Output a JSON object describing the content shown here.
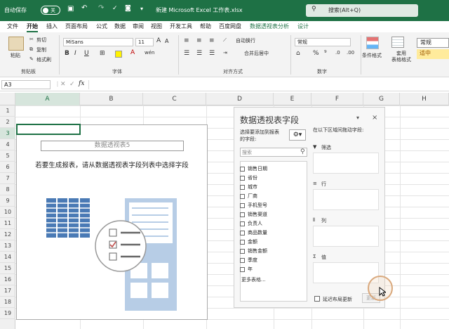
{
  "titlebar": {
    "autosave": "自动保存",
    "toggle": "关",
    "filename": "新建 Microsoft Excel 工作表.xlsx",
    "search": "搜索(Alt+Q)"
  },
  "menu": [
    "文件",
    "开始",
    "插入",
    "页面布局",
    "公式",
    "数据",
    "审阅",
    "视图",
    "开发工具",
    "帮助",
    "百度网盘",
    "数据透视表分析",
    "设计"
  ],
  "ribbon": {
    "paste": "粘贴",
    "cut": "剪切",
    "copy": "复制",
    "format_painter": "格式刷",
    "clipboard": "剪贴板",
    "font_name": "MiSans",
    "font_size": "11",
    "font": "字体",
    "wrap": "自动换行",
    "merge": "合并后居中",
    "alignment": "对齐方式",
    "number_format": "常规",
    "number": "数字",
    "cond_format": "条件格式",
    "table_format": "套用\n表格格式",
    "style_normal": "常规",
    "style_medium": "适中"
  },
  "formula": {
    "name_box": "A3",
    "fx": "fx"
  },
  "columns": [
    "A",
    "B",
    "C",
    "D",
    "E",
    "F",
    "G",
    "H"
  ],
  "rows": [
    "1",
    "2",
    "3",
    "4",
    "5",
    "6",
    "7",
    "8",
    "9",
    "10",
    "11",
    "12",
    "13",
    "14",
    "15",
    "16",
    "17",
    "18",
    "19"
  ],
  "pivot": {
    "name": "数据透视表5",
    "message": "若要生成报表，请从数据透视表字段列表中选择字段"
  },
  "pane": {
    "title": "数据透视表字段",
    "choose": "选择要添加到报表\n的字段:",
    "search_placeholder": "搜索",
    "fields": [
      "销售日期",
      "省份",
      "城市",
      "厂商",
      "手机型号",
      "销售渠道",
      "负责人",
      "商品数量",
      "金额",
      "销售金额",
      "季度",
      "年"
    ],
    "more": "更多表格...",
    "drag": "在以下区域间拖动字段:",
    "areas": {
      "filter": "筛选",
      "rows": "行",
      "cols": "列",
      "values": "值"
    },
    "defer": "延迟布局更新",
    "update": "更新"
  }
}
